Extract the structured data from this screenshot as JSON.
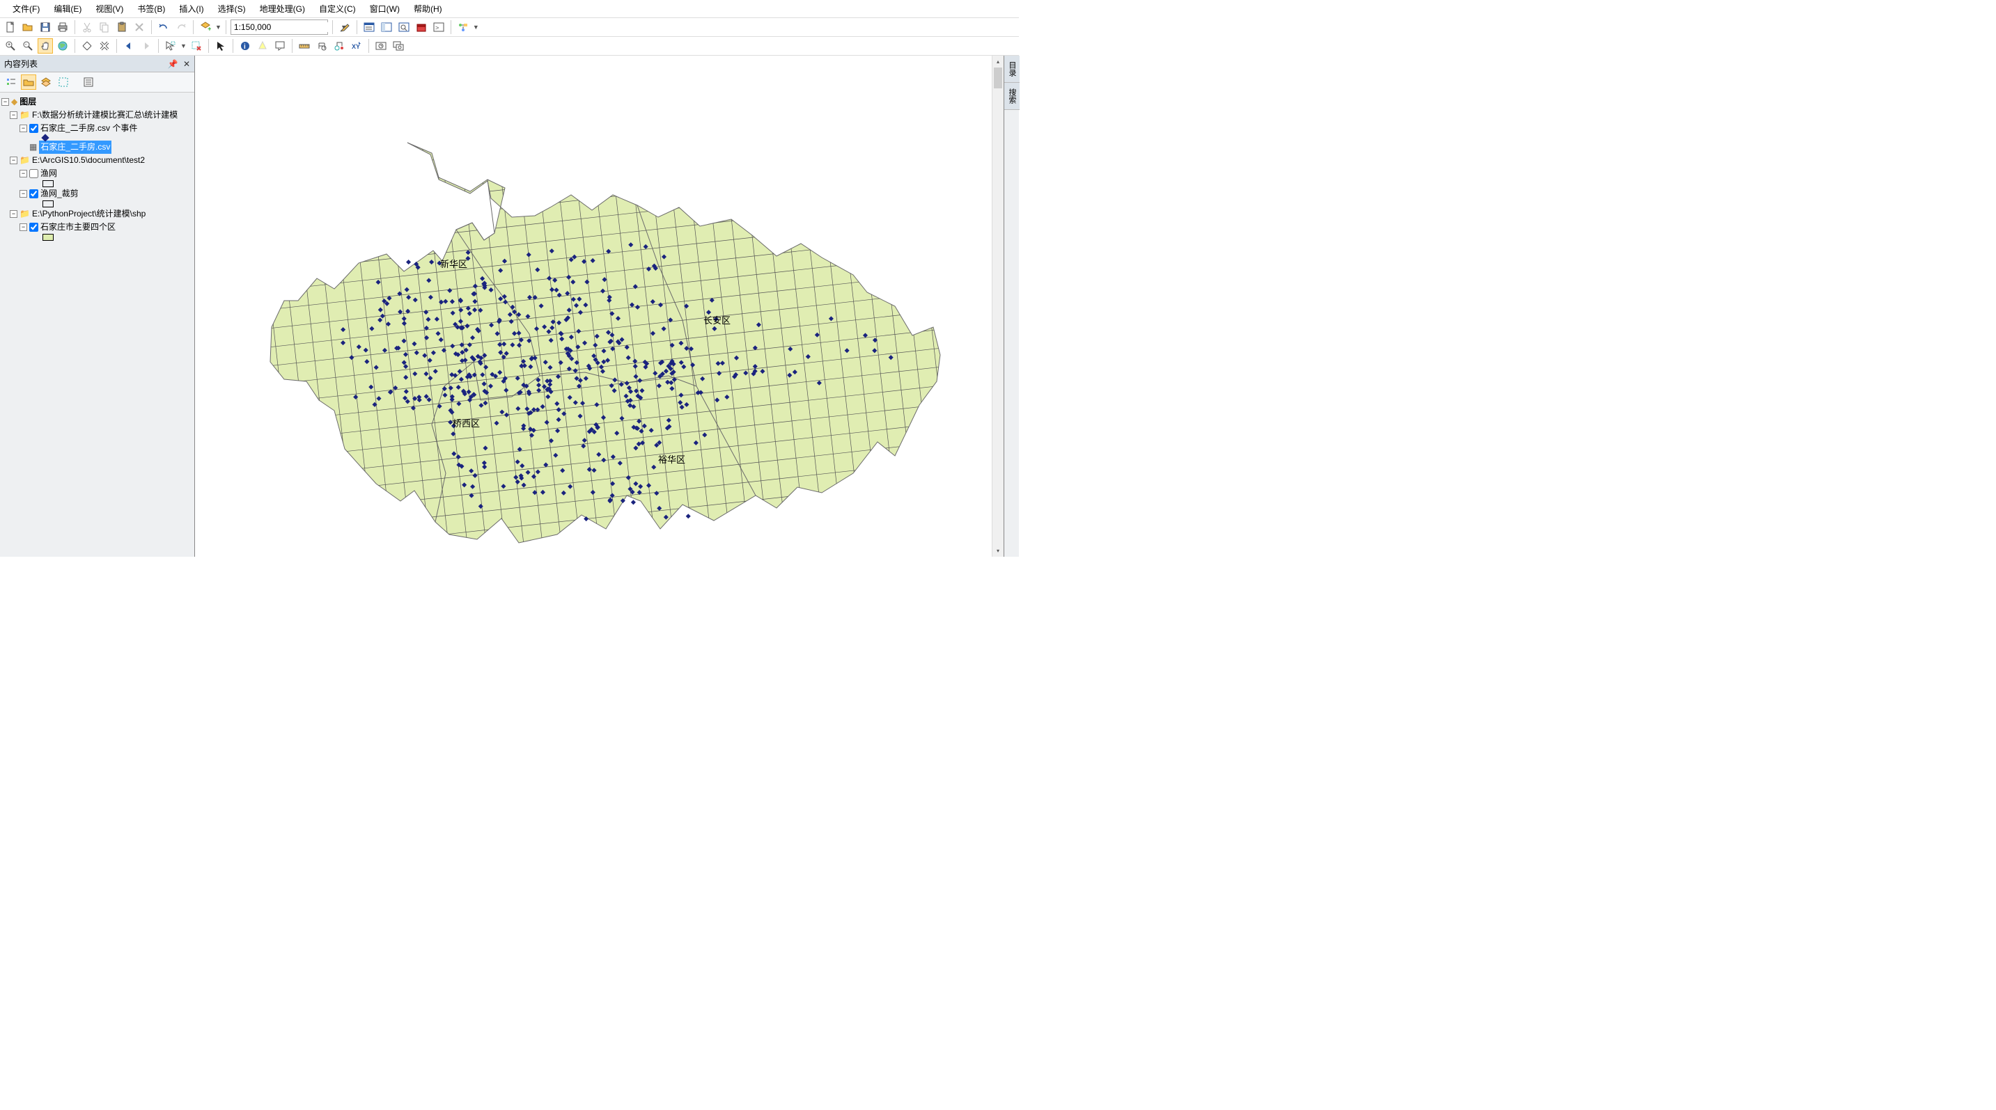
{
  "menu": {
    "file": "文件(F)",
    "edit": "编辑(E)",
    "view": "视图(V)",
    "bookmarks": "书签(B)",
    "insert": "插入(I)",
    "select": "选择(S)",
    "geoprocessing": "地理处理(G)",
    "customize": "自定义(C)",
    "window": "窗口(W)",
    "help": "帮助(H)"
  },
  "scale_value": "1:150,000",
  "toc": {
    "title": "内容列表",
    "root": "图层",
    "frame1": {
      "label": "F:\\数据分析统计建模比赛汇总\\统计建模",
      "layer1": "石家庄_二手房.csv 个事件",
      "table1": "石家庄_二手房.csv"
    },
    "frame2": {
      "label": "E:\\ArcGIS10.5\\document\\test2",
      "layer1": "渔网",
      "layer2": "渔网_裁剪"
    },
    "frame3": {
      "label": "E:\\PythonProject\\统计建模\\shp",
      "layer1": "石家庄市主要四个区"
    }
  },
  "map": {
    "labels": {
      "xinhua": "新华区",
      "changan": "长安区",
      "qiaoxi": "桥西区",
      "yuhua": "裕华区"
    }
  },
  "side": {
    "catalog": "目录",
    "search": "搜索"
  }
}
